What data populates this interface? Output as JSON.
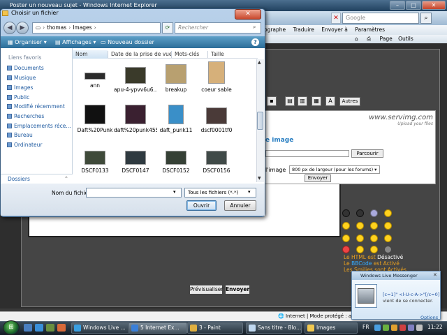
{
  "ie": {
    "title": "Poster un nouveau sujet - Windows Internet Explorer",
    "search_placeholder": "Google",
    "toolbar_items": [
      "ographe",
      "Traduire",
      "Envoyer à",
      "Paramètres"
    ],
    "toolbar2_items": [
      "Page",
      "Outils"
    ],
    "status_text": "Internet | Mode protégé : activé"
  },
  "forum": {
    "autres_label": "Autres",
    "servimg": {
      "logo": "www.servimg.com",
      "tagline": "Upload your files",
      "heading": "e image",
      "browse_label": "Parcourir",
      "size_label": "l'image",
      "size_value": "800 px de largeur (pour les forums)",
      "send_label": "Envoyer"
    },
    "bbinfo": {
      "html": "Le HTML est",
      "html_state": "Désactivé",
      "bbcode_pre": "Le",
      "bbcode_word": "BBCode",
      "bbcode_state": "est Activé",
      "smilies": "Les Smilies sont Activés"
    },
    "preview_label": "Prévisualiser",
    "send_label": "Envoyer"
  },
  "dialog": {
    "title": "Choisir un fichier",
    "path": [
      "thomas",
      "Images"
    ],
    "search_placeholder": "Rechercher",
    "commands": {
      "organize": "Organiser",
      "views": "Affichages",
      "new_folder": "Nouveau dossier"
    },
    "columns": [
      "Nom",
      "Date de la prise de vue",
      "Mots-clés",
      "Taille"
    ],
    "favorites_header": "Liens favoris",
    "favorites": [
      "Documents",
      "Musique",
      "Images",
      "Public",
      "Modifié récemment",
      "Recherches",
      "Emplacements réce...",
      "Bureau",
      "Ordinateur"
    ],
    "folders_label": "Dossiers",
    "files": [
      {
        "name": "ann",
        "color": "#2b2b2b"
      },
      {
        "name": "apu-4-ypvv6u6...",
        "color": "#3a3a2a"
      },
      {
        "name": "breakup",
        "color": "#b8a070"
      },
      {
        "name": "coeur sable",
        "color": "#d6b07a"
      },
      {
        "name": "Daft%20Punk",
        "color": "#111111"
      },
      {
        "name": "daft%20punk455",
        "color": "#3a2030"
      },
      {
        "name": "daft_punk11",
        "color": "#3a8fc8"
      },
      {
        "name": "dscf0001tf0",
        "color": "#4a3a38"
      },
      {
        "name": "DSCF0133",
        "color": "#3f4a3a"
      },
      {
        "name": "DSCF0147",
        "color": "#2f3a40"
      },
      {
        "name": "DSCF0152",
        "color": "#354035"
      },
      {
        "name": "DSCF0156",
        "color": "#404a48"
      }
    ],
    "filename_label": "Nom du fichier",
    "filename_value": "",
    "filetype_value": "Tous les fichiers (*.*)",
    "open_label": "Ouvrir",
    "cancel_label": "Annuler"
  },
  "messenger": {
    "title": "Windows Live Messenger",
    "contact": "[c=1]\" <l-U-c-A->\"[/c=0]",
    "message": "vient de se connecter.",
    "options_label": "Options"
  },
  "taskbar": {
    "tasks": [
      "Windows Live ...",
      "5 Internet Ex...",
      "3 - Paint",
      "Sans titre - Blo...",
      "Images"
    ],
    "lang": "FR",
    "clock": "11:22"
  },
  "colors": {
    "ie_title": "#20415f",
    "cmd_bar": "#2a6c98",
    "link_blue": "#1e5aa0",
    "bb_orange": "#e8a020"
  }
}
